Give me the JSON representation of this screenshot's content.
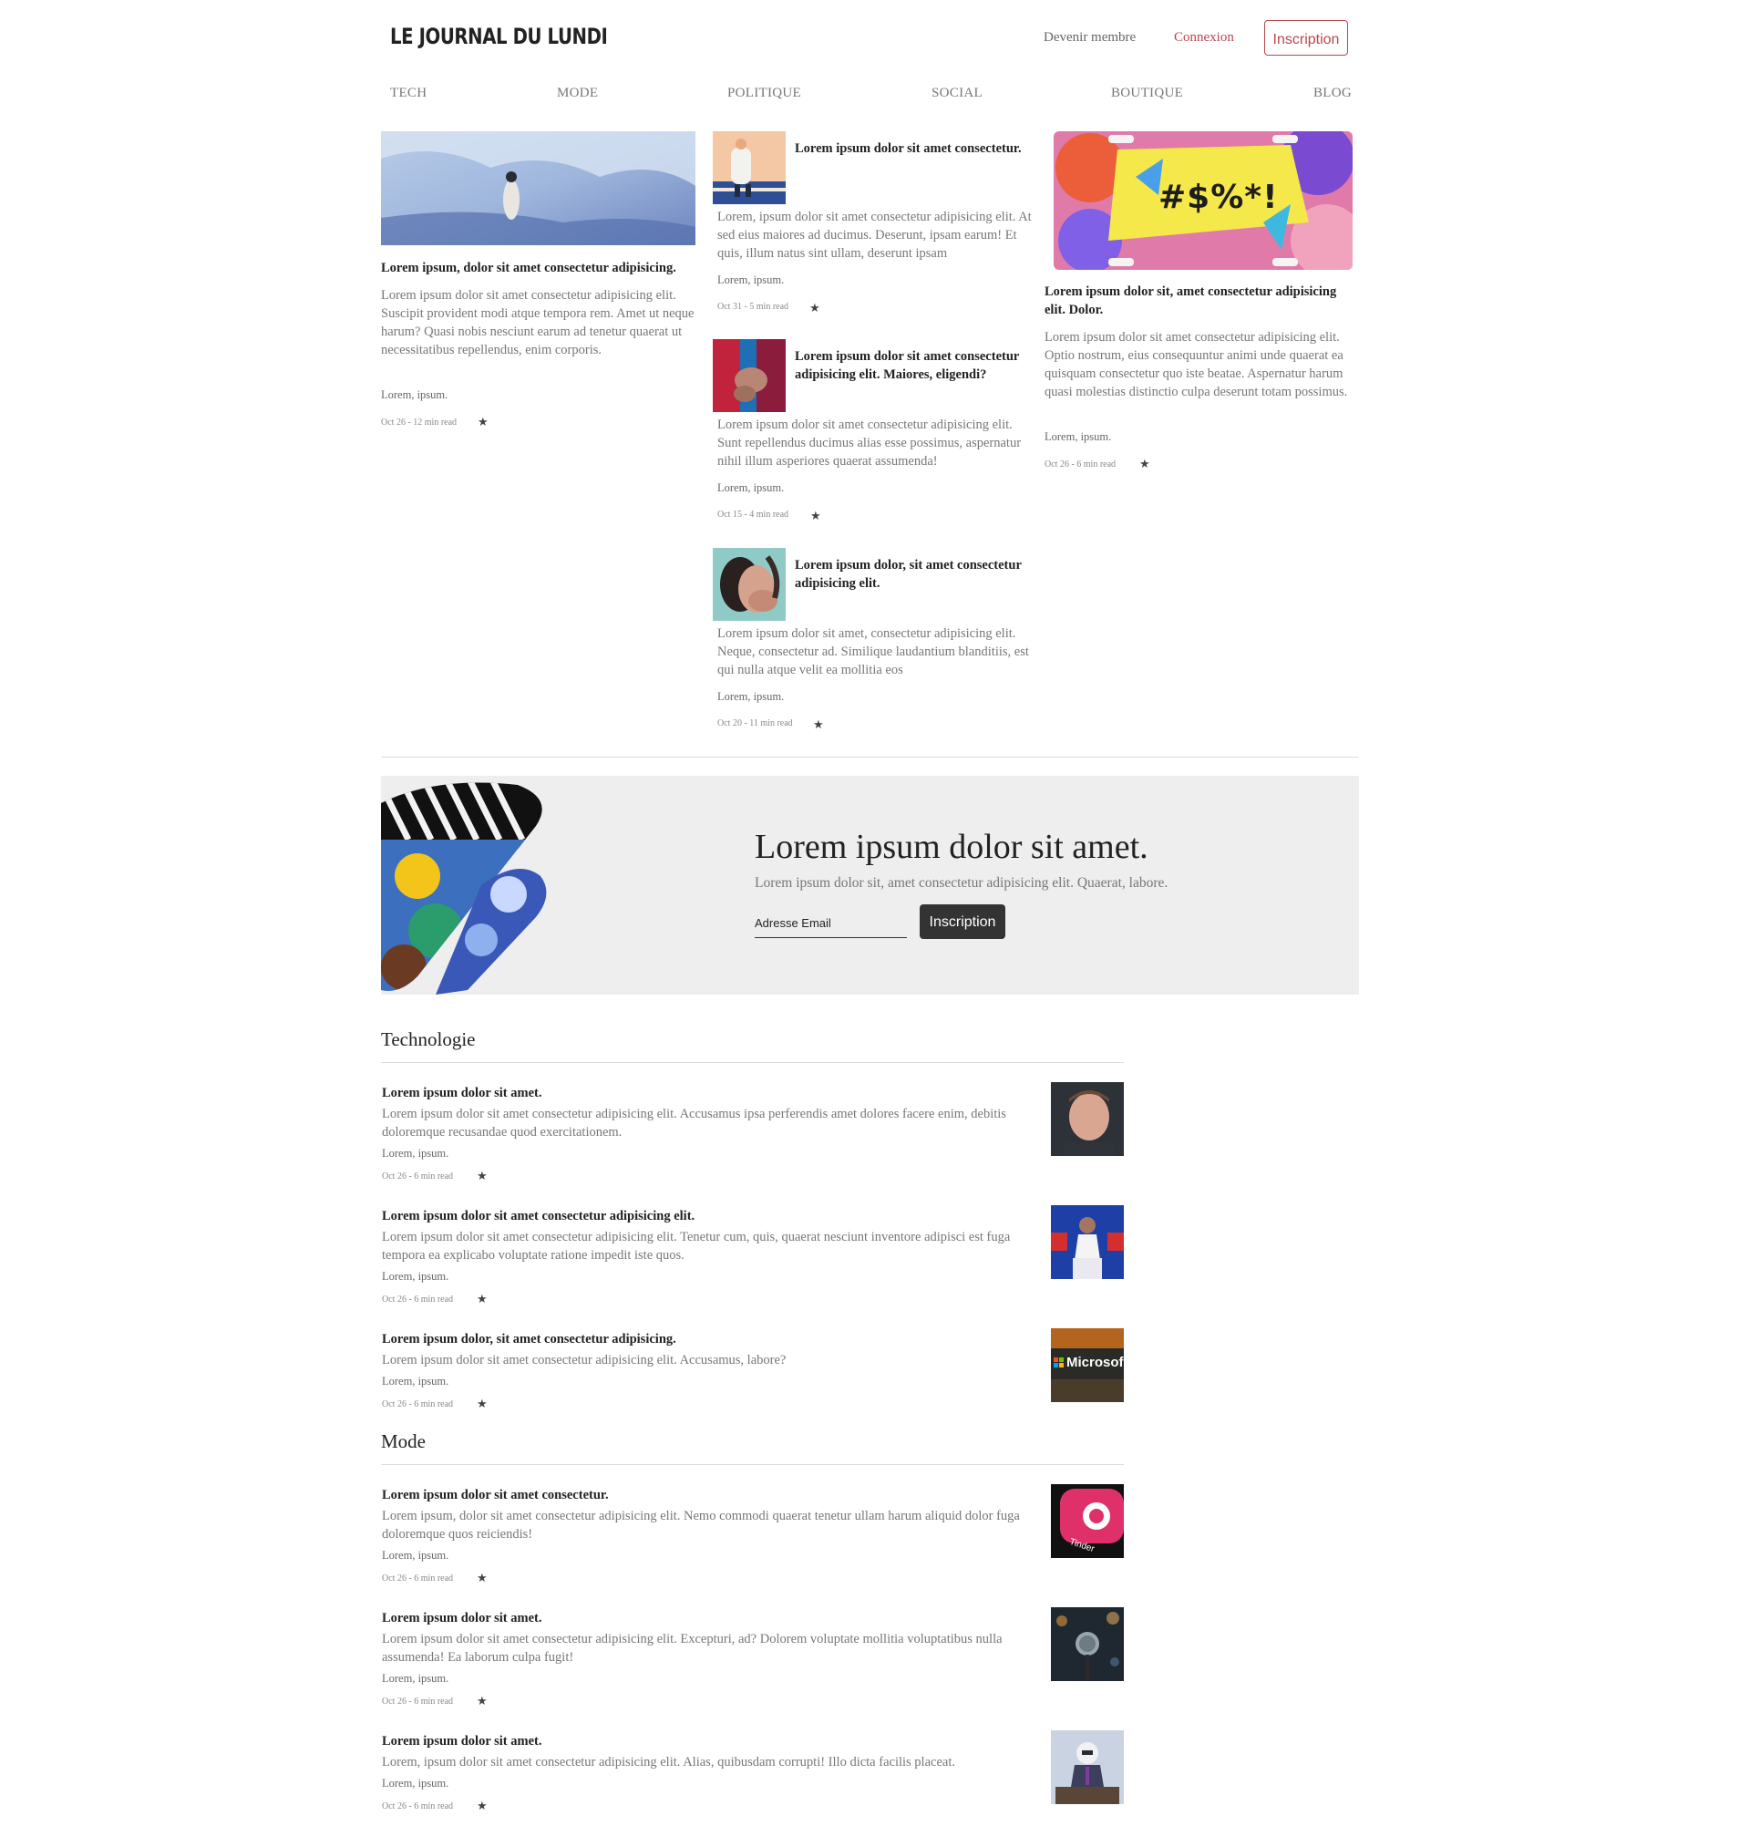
{
  "header": {
    "logo": "LE JOURNAL DU LUNDI",
    "member_link": "Devenir membre",
    "login_link": "Connexion",
    "signup_button": "Inscription"
  },
  "nav": [
    "TECH",
    "MODE",
    "POLITIQUE",
    "SOCIAL",
    "BOUTIQUE",
    "BLOG"
  ],
  "featured": {
    "left": {
      "title": "Lorem ipsum, dolor sit amet consectetur adipisicing.",
      "body": "Lorem ipsum dolor sit amet consectetur adipisicing elit. Suscipit provident modi atque tempora rem. Amet ut neque harum? Quasi nobis nesciunt earum ad tenetur quaerat ut necessitatibus repellendus, enim corporis.",
      "author": "Lorem, ipsum.",
      "meta": "Oct 26 - 12 min read"
    },
    "middle": [
      {
        "title": "Lorem ipsum dolor sit amet consectetur.",
        "body": "Lorem, ipsum dolor sit amet consectetur adipisicing elit. At sed eius maiores ad ducimus. Deserunt, ipsam earum! Et quis, illum natus sint ullam, deserunt ipsam",
        "author": "Lorem, ipsum.",
        "meta": "Oct 31 - 5 min read"
      },
      {
        "title": "Lorem ipsum dolor sit amet consectetur adipisicing elit. Maiores, eligendi?",
        "body": "Lorem ipsum dolor sit amet consectetur adipisicing elit. Sunt repellendus ducimus alias esse possimus, aspernatur nihil illum asperiores quaerat assumenda!",
        "author": "Lorem, ipsum.",
        "meta": "Oct 15 - 4 min read"
      },
      {
        "title": "Lorem ipsum dolor, sit amet consectetur adipisicing elit.",
        "body": "Lorem ipsum dolor sit amet, consectetur adipisicing elit. Neque, consectetur ad. Similique laudantium blanditiis, est qui nulla atque velit ea mollitia eos",
        "author": "Lorem, ipsum.",
        "meta": "Oct 20 - 11 min read"
      }
    ],
    "right": {
      "plate_text": "#$%*!",
      "title": "Lorem ipsum dolor sit, amet consectetur adipisicing elit. Dolor.",
      "body": "Lorem ipsum dolor sit amet consectetur adipisicing elit. Optio nostrum, eius consequuntur animi unde quaerat ea quisquam consectetur quo iste beatae. Aspernatur harum quasi molestias distinctio culpa deserunt totam possimus.",
      "author": "Lorem, ipsum.",
      "meta": "Oct 26 - 6 min read"
    }
  },
  "newsletter": {
    "title": "Lorem ipsum dolor sit amet.",
    "subtitle": "Lorem ipsum dolor sit, amet consectetur adipisicing elit. Quaerat, labore.",
    "email_placeholder": "Adresse Email",
    "button": "Inscription"
  },
  "sections": [
    {
      "heading": "Technologie",
      "articles": [
        {
          "title": "Lorem ipsum dolor sit amet.",
          "body": "Lorem ipsum dolor sit amet consectetur adipisicing elit. Accusamus ipsa perferendis amet dolores facere enim, debitis doloremque recusandae quod exercitationem.",
          "author": "Lorem, ipsum.",
          "meta": "Oct 26 - 6 min read"
        },
        {
          "title": "Lorem ipsum dolor sit amet consectetur adipisicing elit.",
          "body": "Lorem ipsum dolor sit amet consectetur adipisicing elit. Tenetur cum, quis, quaerat nesciunt inventore adipisci est fuga tempora ea explicabo voluptate ratione impedit iste quos.",
          "author": "Lorem, ipsum.",
          "meta": "Oct 26 - 6 min read"
        },
        {
          "title": "Lorem ipsum dolor, sit amet consectetur adipisicing.",
          "body": "Lorem ipsum dolor sit amet consectetur adipisicing elit. Accusamus, labore?",
          "author": "Lorem, ipsum.",
          "meta": "Oct 26 - 6 min read",
          "thumb_text": "Microsof"
        }
      ]
    },
    {
      "heading": "Mode",
      "articles": [
        {
          "title": "Lorem ipsum dolor sit amet consectetur.",
          "body": "Lorem ipsum, dolor sit amet consectetur adipisicing elit. Nemo commodi quaerat tenetur ullam harum aliquid dolor fuga doloremque quos reiciendis!",
          "author": "Lorem, ipsum.",
          "meta": "Oct 26 - 6 min read",
          "thumb_text": "Tinder"
        },
        {
          "title": "Lorem ipsum dolor sit amet.",
          "body": "Lorem ipsum dolor sit amet consectetur adipisicing elit. Excepturi, ad? Dolorem voluptate mollitia voluptatibus nulla assumenda! Ea laborum culpa fugit!",
          "author": "Lorem, ipsum.",
          "meta": "Oct 26 - 6 min read"
        },
        {
          "title": "Lorem ipsum dolor sit amet.",
          "body": "Lorem, ipsum dolor sit amet consectetur adipisicing elit. Alias, quibusdam corrupti! Illo dicta facilis placeat.",
          "author": "Lorem, ipsum.",
          "meta": "Oct 26 - 6 min read"
        }
      ]
    }
  ],
  "colors": {
    "accent": "#b8474f",
    "newsletter_bg": "#eeeeee",
    "button_dark": "#333333"
  }
}
